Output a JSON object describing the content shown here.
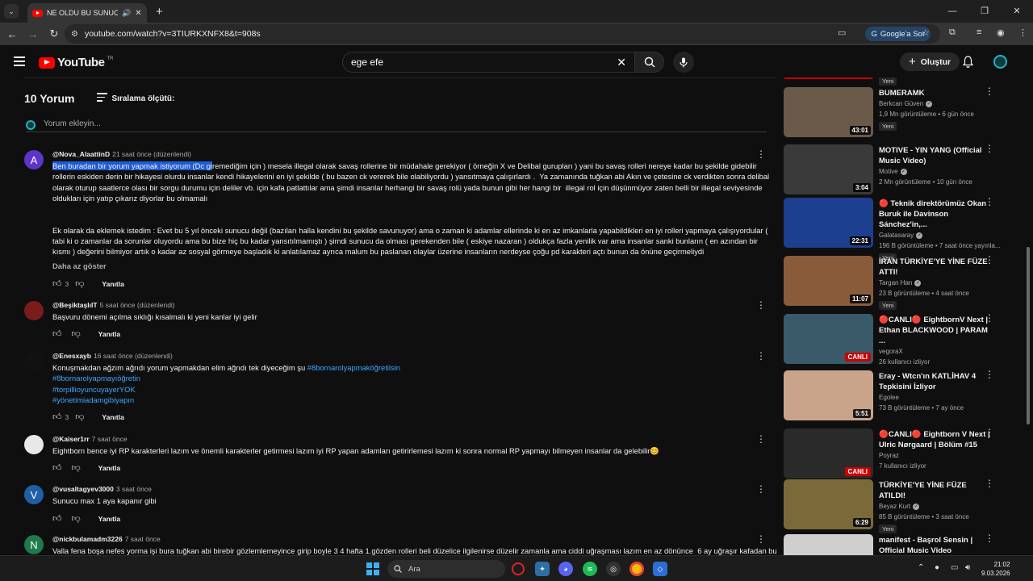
{
  "browser": {
    "tab_title": "NE OLDU BU SUNUCUYA ?!",
    "url": "youtube.com/watch?v=3TIURKXNFX8&t=908s",
    "google_btn": "Google'a Sor"
  },
  "header": {
    "logo": "YouTube",
    "country": "TR",
    "search_value": "ege efe",
    "create_label": "Oluştur"
  },
  "comments_section": {
    "count": "10 Yorum",
    "sort_label": "Sıralama ölçütü:",
    "add_placeholder": "Yorum ekleyin...",
    "show_less": "Daha az göster",
    "reply_label": "Yanıtla",
    "items": [
      {
        "author": "@Nova_AlaattinD",
        "time": "21 saat önce (düzenlendi)",
        "avatar_letter": "A",
        "avatar_color": "#5c35c9",
        "highlight": "Ben buradan bir yorum yapmak istiyorum (Dc gi",
        "text_rest": "remediğim için ) mesela illegal olarak savaş rollerine bir müdahale gerekiyor ( örneğin X ve Delibal gurupları ) yani bu savaş rolleri nereye kadar bu şekilde gidebilir rollerin eskiden derin bir hikayesi olurdu insanlar kendi hikayelerini en iyi şekilde ( bu bazen ck vererek bile olabiliyordu ) yansıtmaya çalışırlardı .  Ya zamanında tuğkan abi Akın ve çetesine ck verdikten sonra delibal olarak oturup saatlerce olası bir sorgu durumu için deliler vb. için kafa patlattılar ama şimdi insanlar herhangi bir savaş rolü yada bunun gibi her hangi bir  illegal rol için düşünmüyor zaten belli bir illegal seviyesinde oldukları için yatıp çıkarız diyorlar bu olmamalı\n\n\nEk olarak da eklemek istedim : Evet bu 5 yıl önceki sunucu değil (bazıları halla kendini bu şekilde savunuyor) ama o zaman ki adamlar ellerinde ki en az imkanlarla yapabildikleri en iyi rolleri yapmaya çalışıyordular ( tabi ki o zamanlar da sorunlar oluyordu ama bu bize hiç bu kadar yansıtılmamıştı ) şimdi sunucu da olması gerekenden bile ( eskiye nazaran ) oldukça fazla yenilik var ama insanlar sanki bunların ( en azından bir kısmı ) değerini bilmiyor artık o kadar az sosyal görmeye başladık ki anlatılamaz ayrıca malum bu paslanan olaylar üzerine insanların nerdeyse çoğu pd karakteri açtı bunun da önüne geçirmeliydi",
        "likes": "3"
      },
      {
        "author": "@BeşiktaşlılT",
        "time": "5 saat önce (düzenlendi)",
        "avatar_color": "#7a1c1c",
        "text": "Başvuru dönemi açılma sıklığı kısalmalı ki yeni kanlar iyi gelir",
        "likes": ""
      },
      {
        "author": "@Enesxayb",
        "time": "16 saat önce (düzenlendi)",
        "avatar_color": "#111111",
        "text": "Konuşmakdan ağzım ağrıdı yorum yapmakdan elim ağrıdı tek diyeceğim şu ",
        "tags": [
          "#8bornarolyapmaköğretilsin",
          "#8bornarolyapmayıöğretin",
          "#torpillioyuncuyayerYOK",
          "#yönetimiadamgibiyapın"
        ],
        "likes": "3"
      },
      {
        "author": "@Kaiser1rr",
        "time": "7 saat önce",
        "avatar_color": "#e8e8e8",
        "text": "Eightborn bence iyi RP karakterleri lazım ve önemli karakterler getirmesi lazım iyi RP yapan adamları getirirlemesi lazım ki sonra normal RP yapmayı bilmeyen insanlar da gelebilir😊",
        "likes": ""
      },
      {
        "author": "@vusaltagyev3000",
        "time": "3 saat önce",
        "avatar_letter": "V",
        "avatar_color": "#1f5fa8",
        "text": "Sunucu max 1 aya kapanır gibi",
        "likes": ""
      },
      {
        "author": "@nickbulamadm3226",
        "time": "7 saat önce",
        "avatar_letter": "N",
        "avatar_color": "#1e7a4b",
        "text": "Valla fena boşa nefes yorma işi bura tuğkan abi birebir gözlemlemeyince girip boyle 3 4 hafta 1.gözden rolleri beli düzelice ilgilenirse düzelir zamanla ama ciddi uğraşması lazım en az dönünce  6 ay uğraşır kafadan bu",
        "likes": ""
      }
    ]
  },
  "sidebar": {
    "new_label": "Yeni",
    "live_label": "CANLI",
    "videos": [
      {
        "title": "BUMERAMK",
        "channel": "Berkcan Güven",
        "verified": true,
        "meta": "1,9 Mn görüntüleme • 6 gün önce",
        "duration": "43:01",
        "new": true,
        "thumb": "#6b5a4a"
      },
      {
        "title": "MOTIVE - YIN YANG (Official Music Video)",
        "channel": "Motive",
        "verified": true,
        "meta": "2 Mn görüntüleme • 10 gün önce",
        "duration": "3:04",
        "new": false,
        "thumb": "#3a3a3a"
      },
      {
        "title": "🔴 Teknik direktörümüz Okan Buruk ile Davinson Sánchez'in,...",
        "channel": "Galatasaray",
        "verified": true,
        "meta": "196 B görüntüleme • 7 saat önce yayınla...",
        "duration": "22:31",
        "new": true,
        "thumb": "#1d3f8f"
      },
      {
        "title": "İRAN TÜRKİYE'YE YİNE FÜZE ATTI!",
        "channel": "Targan Han",
        "verified": true,
        "meta": "23 B görüntüleme • 4 saat önce",
        "duration": "11:07",
        "new": true,
        "thumb": "#8a5b3a"
      },
      {
        "title": "🔴CANLI🔴 EightbornV Next | Ethan BLACKWOOD | PARAM ...",
        "channel": "vegoraX",
        "verified": false,
        "meta": "26 kullanıcı izliyor",
        "duration": "",
        "live": true,
        "new": false,
        "thumb": "#3a5a6a"
      },
      {
        "title": "Eray - Wtcn'ın KATLİHAV 4 Tepkisini İzliyor",
        "channel": "Egolee",
        "verified": false,
        "meta": "73 B görüntüleme • 7 ay önce",
        "duration": "5:51",
        "new": false,
        "thumb": "#c9a48a"
      },
      {
        "title": "🔴CANLI🔴 Eightborn V Next | Ulric Nørgaard | Bölüm #15",
        "channel": "Poyraz",
        "verified": false,
        "meta": "7 kullanıcı izliyor",
        "duration": "",
        "live": true,
        "new": false,
        "thumb": "#2a2a2a"
      },
      {
        "title": "TÜRKİYE'YE YİNE FÜZE ATILDI!",
        "channel": "Beyaz Kurt",
        "verified": true,
        "meta": "85 B görüntüleme • 3 saat önce",
        "duration": "6:29",
        "new": true,
        "thumb": "#7a6a3a"
      },
      {
        "title": "manifest - Başrol Sensin | Official Music Video",
        "channel": "",
        "verified": false,
        "meta": "",
        "duration": "",
        "new": false,
        "thumb": "#cfcfcf"
      }
    ]
  },
  "taskbar": {
    "search": "Ara",
    "time": "21:02",
    "date": "9.03.2026"
  }
}
